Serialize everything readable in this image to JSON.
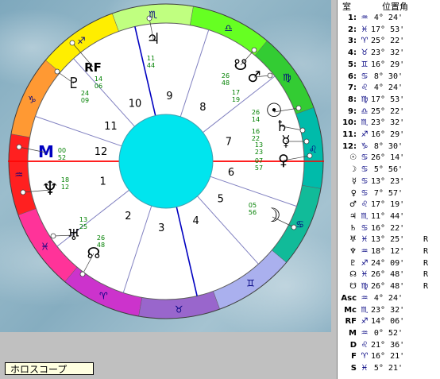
{
  "caption": "ホロスコープ",
  "colors": {
    "asc_line": "#ff0000",
    "mc_line": "#0000c0",
    "center": "#00e5ee",
    "house_line": "#8080c0"
  },
  "panel": {
    "header_house": "室",
    "header_position": "位置角",
    "rows": [
      {
        "label": "1:",
        "sign": "aquarius",
        "glyph": "♒",
        "deg": "4° 24'",
        "r": ""
      },
      {
        "label": "2:",
        "sign": "pisces",
        "glyph": "♓",
        "deg": "17° 53'",
        "r": ""
      },
      {
        "label": "3:",
        "sign": "aries",
        "glyph": "♈",
        "deg": "25° 22'",
        "r": ""
      },
      {
        "label": "4:",
        "sign": "taurus",
        "glyph": "♉",
        "deg": "23° 32'",
        "r": ""
      },
      {
        "label": "5:",
        "sign": "gemini",
        "glyph": "♊",
        "deg": "16° 29'",
        "r": ""
      },
      {
        "label": "6:",
        "sign": "cancer",
        "glyph": "♋",
        "deg": "8° 30'",
        "r": ""
      },
      {
        "label": "7:",
        "sign": "leo",
        "glyph": "♌",
        "deg": "4° 24'",
        "r": ""
      },
      {
        "label": "8:",
        "sign": "virgo",
        "glyph": "♍",
        "deg": "17° 53'",
        "r": ""
      },
      {
        "label": "9:",
        "sign": "libra",
        "glyph": "♎",
        "deg": "25° 22'",
        "r": ""
      },
      {
        "label": "10:",
        "sign": "scorpio",
        "glyph": "♏",
        "deg": "23° 32'",
        "r": ""
      },
      {
        "label": "11:",
        "sign": "sagittarius",
        "glyph": "♐",
        "deg": "16° 29'",
        "r": ""
      },
      {
        "label": "12:",
        "sign": "capricorn",
        "glyph": "♑",
        "deg": "8° 30'",
        "r": ""
      },
      {
        "label": "☉",
        "sign": "cancer",
        "glyph": "♋",
        "deg": "26° 14'",
        "r": ""
      },
      {
        "label": "☽",
        "sign": "cancer",
        "glyph": "♋",
        "deg": "5° 56'",
        "r": ""
      },
      {
        "label": "☿",
        "sign": "cancer",
        "glyph": "♋",
        "deg": "13° 23'",
        "r": ""
      },
      {
        "label": "♀",
        "sign": "cancer",
        "glyph": "♋",
        "deg": "7° 57'",
        "r": ""
      },
      {
        "label": "♂",
        "sign": "leo",
        "glyph": "♌",
        "deg": "17° 19'",
        "r": ""
      },
      {
        "label": "♃",
        "sign": "scorpio",
        "glyph": "♏",
        "deg": "11° 44'",
        "r": ""
      },
      {
        "label": "♄",
        "sign": "cancer",
        "glyph": "♋",
        "deg": "16° 22'",
        "r": ""
      },
      {
        "label": "♅",
        "sign": "pisces",
        "glyph": "♓",
        "deg": "13° 25'",
        "r": "R"
      },
      {
        "label": "♆",
        "sign": "aquarius",
        "glyph": "♒",
        "deg": "18° 12'",
        "r": "R"
      },
      {
        "label": "♇",
        "sign": "sagittarius",
        "glyph": "♐",
        "deg": "24° 09'",
        "r": "R"
      },
      {
        "label": "☊",
        "sign": "pisces",
        "glyph": "♓",
        "deg": "26° 48'",
        "r": "R"
      },
      {
        "label": "☋",
        "sign": "virgo",
        "glyph": "♍",
        "deg": "26° 48'",
        "r": "R"
      },
      {
        "label": "Asc",
        "sign": "aquarius",
        "glyph": "♒",
        "deg": "4° 24'",
        "r": ""
      },
      {
        "label": "Mc",
        "sign": "scorpio",
        "glyph": "♏",
        "deg": "23° 32'",
        "r": ""
      },
      {
        "label": "RF",
        "sign": "sagittarius",
        "glyph": "♐",
        "deg": "14° 06'",
        "r": ""
      },
      {
        "label": "M",
        "sign": "aquarius",
        "glyph": "♒",
        "deg": "0° 52'",
        "r": ""
      },
      {
        "label": "D",
        "sign": "leo",
        "glyph": "♌",
        "deg": "21° 36'",
        "r": ""
      },
      {
        "label": "F",
        "sign": "aries",
        "glyph": "♈",
        "deg": "16° 21'",
        "r": ""
      },
      {
        "label": "S",
        "sign": "pisces",
        "glyph": "♓",
        "deg": "5° 21'",
        "r": ""
      }
    ]
  },
  "chart": {
    "house_numbers": [
      "1",
      "2",
      "3",
      "4",
      "5",
      "6",
      "7",
      "8",
      "9",
      "10",
      "11",
      "12"
    ],
    "planets": [
      {
        "name": "sun",
        "glyph": "☉",
        "deg": "26",
        "min": "14"
      },
      {
        "name": "saturn",
        "glyph": "♄",
        "deg": "16",
        "min": "22"
      },
      {
        "name": "mercury",
        "glyph": "☿",
        "deg": "13",
        "min": "23"
      },
      {
        "name": "venus",
        "glyph": "♀",
        "deg": "07",
        "min": "57"
      },
      {
        "name": "moon",
        "glyph": "☽",
        "deg": "05",
        "min": "56"
      },
      {
        "name": "mars",
        "glyph": "♂",
        "deg": "17",
        "min": "19"
      },
      {
        "name": "south-node",
        "glyph": "☋",
        "deg": "26",
        "min": "48"
      },
      {
        "name": "jupiter",
        "glyph": "♃",
        "deg": "11",
        "min": "44"
      },
      {
        "name": "pluto",
        "glyph": "♇",
        "deg": "24",
        "min": "09"
      },
      {
        "name": "part-of-fortune",
        "glyph": "RF",
        "deg": "14",
        "min": "06"
      },
      {
        "name": "m-point",
        "glyph": "M",
        "deg": "00",
        "min": "52"
      },
      {
        "name": "neptune",
        "glyph": "♆",
        "deg": "18",
        "min": "12"
      },
      {
        "name": "uranus",
        "glyph": "♅",
        "deg": "13",
        "min": "25"
      },
      {
        "name": "north-node",
        "glyph": "☊",
        "deg": "26",
        "min": "48"
      }
    ]
  }
}
